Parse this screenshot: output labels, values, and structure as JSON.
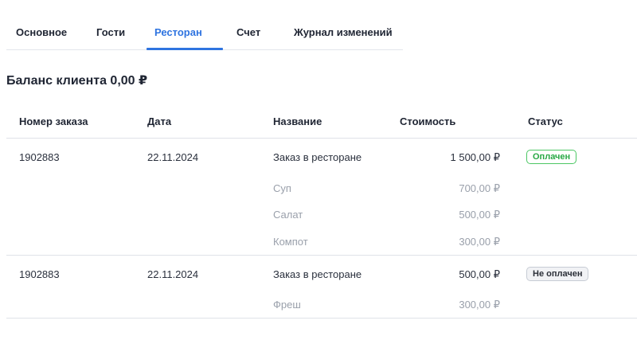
{
  "tabs": [
    {
      "label": "Основное"
    },
    {
      "label": "Гости"
    },
    {
      "label": "Ресторан",
      "active": true
    },
    {
      "label": "Счет"
    },
    {
      "label": "Журнал изменений"
    }
  ],
  "balance_text": "Баланс клиента 0,00 ₽",
  "table": {
    "headers": [
      "Номер заказа",
      "Дата",
      "Название",
      "Стоимость",
      "Статус"
    ],
    "orders": [
      {
        "number": "1902883",
        "date": "22.11.2024",
        "title": "Заказ в ресторане",
        "cost": "1 500,00 ₽",
        "status": "Оплачен",
        "items": [
          {
            "name": "Суп",
            "cost": "700,00 ₽"
          },
          {
            "name": "Салат",
            "cost": "500,00 ₽"
          },
          {
            "name": "Компот",
            "cost": "300,00 ₽"
          }
        ]
      },
      {
        "number": "1902883",
        "date": "22.11.2024",
        "title": "Заказ в ресторане",
        "cost": "500,00 ₽",
        "status": "Не оплачен",
        "items": [
          {
            "name": "Фреш",
            "cost": "300,00 ₽"
          }
        ]
      }
    ]
  },
  "colors": {
    "accent": "#2f74e0",
    "paid": "#27a844",
    "unpaid_bg": "#f1f2f5",
    "muted_text": "#9aa0ab"
  }
}
